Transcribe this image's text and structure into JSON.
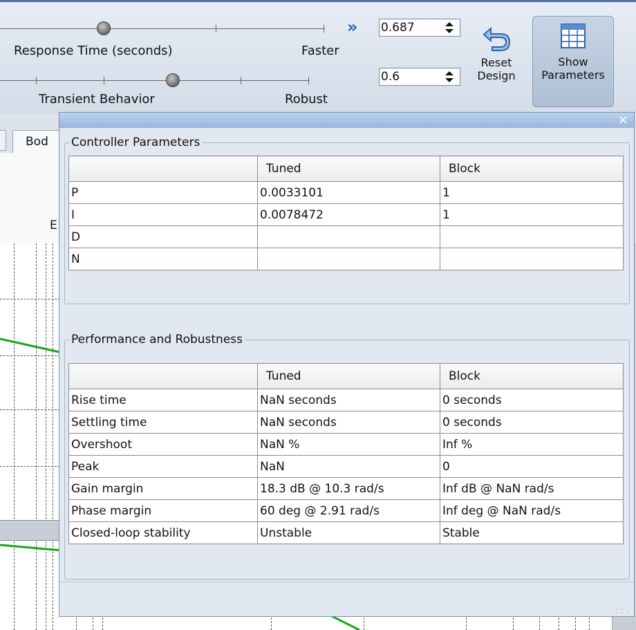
{
  "toolbar": {
    "response_time_label": "Response Time (seconds)",
    "faster_label": "Faster",
    "transient_label": "Transient Behavior",
    "robust_label": "Robust",
    "chevron": "»",
    "response_value": "0.687",
    "transient_value": "0.6",
    "reset_label_1": "Reset",
    "reset_label_2": "Design",
    "show_label_1": "Show",
    "show_label_2": "Parameters"
  },
  "background": {
    "tab_label": "Bod",
    "axis_fragment": "E"
  },
  "panel": {
    "close_glyph": "×",
    "controller": {
      "title": "Controller Parameters",
      "columns": [
        "",
        "Tuned",
        "Block"
      ],
      "rows": [
        [
          "P",
          "0.0033101",
          "1"
        ],
        [
          "I",
          "0.0078472",
          "1"
        ],
        [
          "D",
          "",
          ""
        ],
        [
          "N",
          "",
          ""
        ]
      ]
    },
    "performance": {
      "title": "Performance and Robustness",
      "columns": [
        "",
        "Tuned",
        "Block"
      ],
      "rows": [
        [
          "Rise time",
          "NaN seconds",
          "0 seconds"
        ],
        [
          "Settling time",
          "NaN seconds",
          "0 seconds"
        ],
        [
          "Overshoot",
          "NaN %",
          "Inf %"
        ],
        [
          "Peak",
          "NaN",
          "0"
        ],
        [
          "Gain margin",
          "18.3 dB @ 10.3 rad/s",
          "Inf dB @ NaN rad/s"
        ],
        [
          "Phase margin",
          "60 deg @ 2.91 rad/s",
          "Inf deg @ NaN rad/s"
        ],
        [
          "Closed-loop stability",
          "Unstable",
          "Stable"
        ]
      ]
    }
  },
  "icons": {
    "reset": "undo-arrow-icon",
    "show": "table-grid-icon",
    "chevron": "double-chevron-right-icon"
  }
}
